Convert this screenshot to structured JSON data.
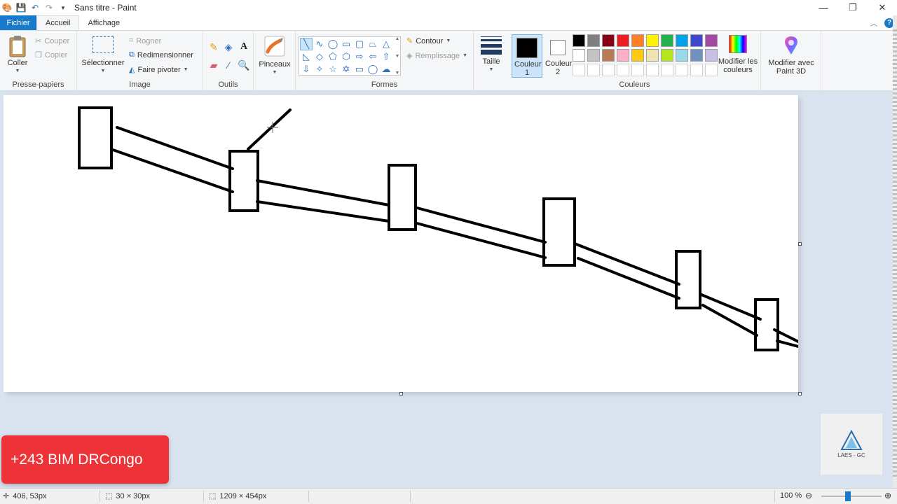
{
  "window": {
    "title": "Sans titre - Paint",
    "minimize": "—",
    "restore": "❐",
    "close": "✕"
  },
  "tabs": {
    "file": "Fichier",
    "home": "Accueil",
    "view": "Affichage"
  },
  "ribbon": {
    "clipboard": {
      "group": "Presse-papiers",
      "paste": "Coller",
      "cut": "Couper",
      "copy": "Copier"
    },
    "image": {
      "group": "Image",
      "select": "Sélectionner",
      "crop": "Rogner",
      "resize": "Redimensionner",
      "rotate": "Faire pivoter"
    },
    "tools": {
      "group": "Outils"
    },
    "brushes": {
      "label": "Pinceaux"
    },
    "shapes": {
      "group": "Formes",
      "outline": "Contour",
      "fill": "Remplissage"
    },
    "size": {
      "label": "Taille"
    },
    "colors": {
      "group": "Couleurs",
      "color1": "Couleur 1",
      "color2": "Couleur 2",
      "edit": "Modifier les couleurs",
      "color1_value": "#000000",
      "color2_value": "#ffffff",
      "palette": [
        "#000000",
        "#7f7f7f",
        "#880015",
        "#ed1c24",
        "#ff7f27",
        "#fff200",
        "#22b14c",
        "#00a2e8",
        "#3f48cc",
        "#a349a4",
        "#ffffff",
        "#c3c3c3",
        "#b97a57",
        "#ffaec9",
        "#ffc90e",
        "#efe4b0",
        "#b5e61d",
        "#99d9ea",
        "#7092be",
        "#c8bfe7"
      ]
    },
    "paint3d": "Modifier avec Paint 3D"
  },
  "overlay": {
    "badge": "+243 BIM DRCongo",
    "logo": "LAES - GC"
  },
  "status": {
    "cursor": "406, 53px",
    "selection": "30 × 30px",
    "canvas_size": "1209 × 454px",
    "zoom": "100 %",
    "zoom_level": 0.44
  }
}
